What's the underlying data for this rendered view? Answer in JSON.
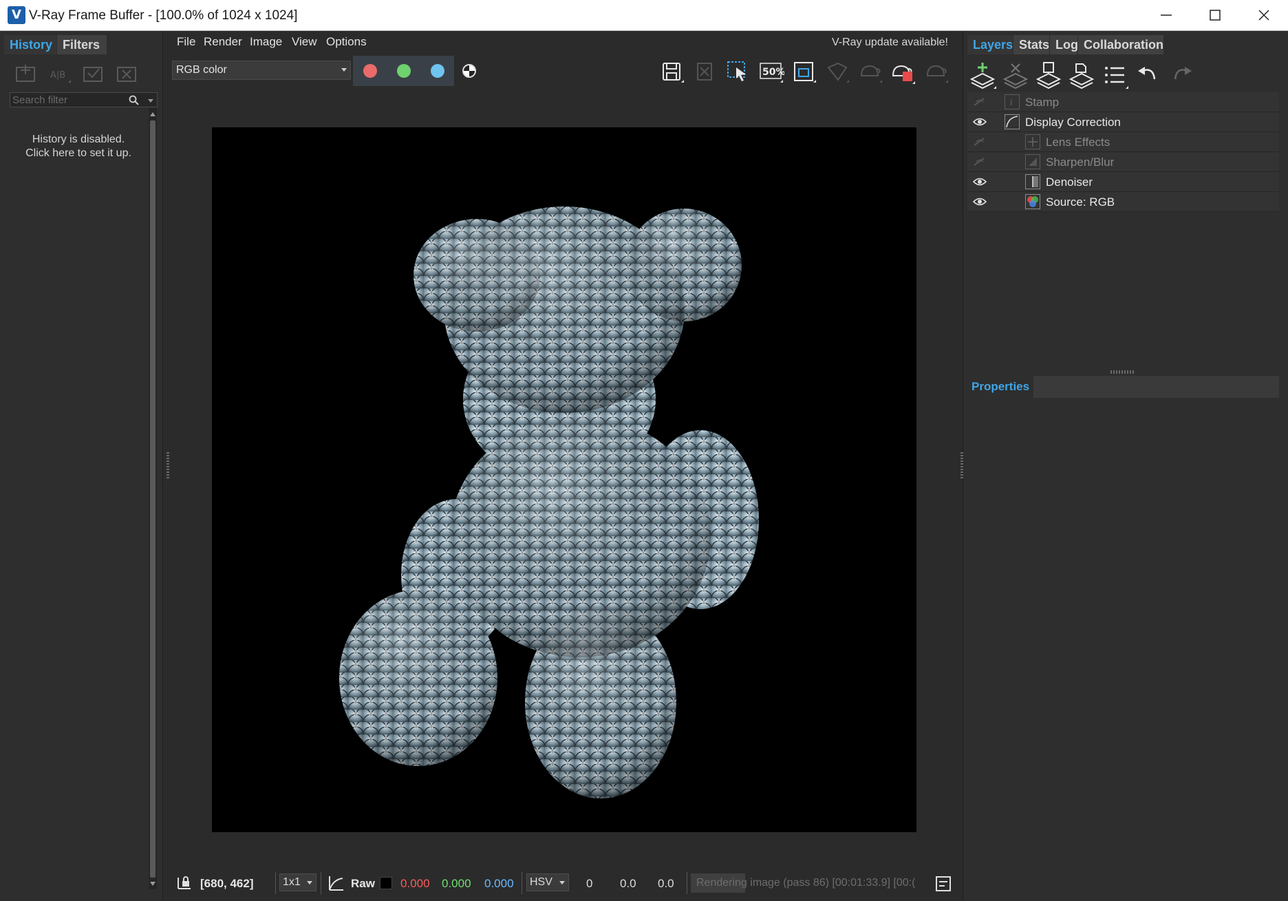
{
  "window": {
    "title": "V-Ray Frame Buffer - [100.0% of 1024 x 1024]",
    "logo_letter": "V"
  },
  "left_panel": {
    "tabs": [
      {
        "label": "History",
        "active": true
      },
      {
        "label": "Filters",
        "active": false
      }
    ],
    "toolbar_icons": [
      "history-save-icon",
      "history-ab-compare-icon",
      "history-load-icon",
      "history-delete-icon"
    ],
    "search": {
      "placeholder": "Search filter",
      "value": ""
    },
    "message_line1": "History is disabled.",
    "message_line2": "Click here to set it up."
  },
  "menu": {
    "items": [
      "File",
      "Render",
      "Image",
      "View",
      "Options"
    ],
    "update_notice": "V-Ray update available!"
  },
  "toolbar": {
    "channel": "RGB color",
    "color_toggles": [
      {
        "name": "red",
        "color": "#ea6b6b"
      },
      {
        "name": "green",
        "color": "#6ed26e"
      },
      {
        "name": "blue",
        "color": "#6ec3ef"
      }
    ],
    "zoom_label": "50%",
    "tool_icons": [
      "save-image-icon",
      "clear-image-icon",
      "region-render-icon",
      "zoom-50-icon",
      "fit-to-window-icon",
      "track-mouse-icon",
      "render-last-icon",
      "stop-render-icon",
      "start-interactive-icon"
    ]
  },
  "render": {
    "subject": "teddy bear with silver scale texture",
    "background_color": "#000000"
  },
  "status": {
    "coords": "[680, 462]",
    "sample_size": "1x1",
    "raw_label": "Raw",
    "r": "0.000",
    "g": "0.000",
    "b": "0.000",
    "color_space": "HSV",
    "h": "0",
    "s": "0.0",
    "v": "0.0",
    "progress_text": "Rendering image (pass 86) [00:01:33.9] [00:(",
    "progress_fraction": 0.23,
    "r_color": "#ff5a5a",
    "g_color": "#6fe06f",
    "b_color": "#6ab8ff"
  },
  "right_panel": {
    "tabs": [
      {
        "label": "Layers",
        "active": true
      },
      {
        "label": "Stats",
        "active": false
      },
      {
        "label": "Log",
        "active": false
      },
      {
        "label": "Collaboration",
        "active": false
      }
    ],
    "layers": [
      {
        "label": "Stamp",
        "enabled": false,
        "indent": 0,
        "icon": "stamp-icon"
      },
      {
        "label": "Display Correction",
        "enabled": true,
        "indent": 0,
        "icon": "curve-icon"
      },
      {
        "label": "Lens Effects",
        "enabled": false,
        "indent": 1,
        "icon": "lens-effects-icon"
      },
      {
        "label": "Sharpen/Blur",
        "enabled": false,
        "indent": 1,
        "icon": "sharpen-blur-icon"
      },
      {
        "label": "Denoiser",
        "enabled": true,
        "indent": 1,
        "icon": "denoiser-icon"
      },
      {
        "label": "Source: RGB",
        "enabled": true,
        "indent": 1,
        "icon": "source-rgb-icon"
      }
    ],
    "properties_title": "Properties"
  },
  "colors": {
    "accent": "#3ea6e8",
    "panel_bg": "#2e2e2e",
    "canvas_bg": "#000000"
  }
}
